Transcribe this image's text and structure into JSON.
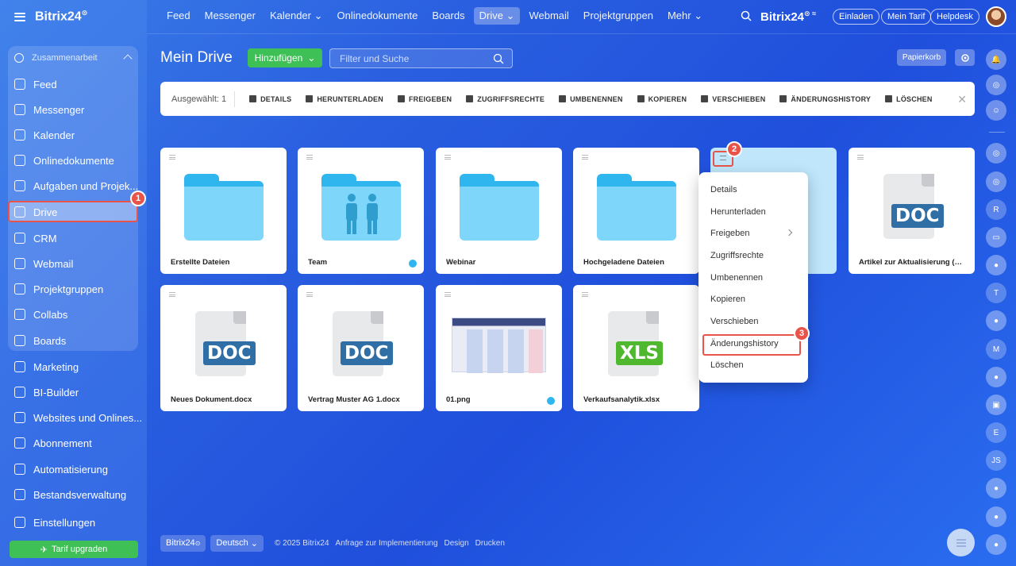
{
  "sidebar": {
    "logo": "Bitrix24",
    "group_label": "Zusammenarbeit",
    "items": [
      {
        "label": "Feed",
        "icon": "feed-icon"
      },
      {
        "label": "Messenger",
        "icon": "chat-icon"
      },
      {
        "label": "Kalender",
        "icon": "calendar-icon"
      },
      {
        "label": "Onlinedokumente",
        "icon": "document-icon"
      },
      {
        "label": "Aufgaben und Projek...",
        "icon": "tasks-icon"
      },
      {
        "label": "Drive",
        "icon": "drive-icon"
      },
      {
        "label": "CRM",
        "icon": "crm-icon"
      },
      {
        "label": "Webmail",
        "icon": "mail-icon"
      },
      {
        "label": "Projektgruppen",
        "icon": "group-icon"
      },
      {
        "label": "Collabs",
        "icon": "collab-icon"
      },
      {
        "label": "Boards",
        "icon": "board-icon"
      },
      {
        "label": "Marketing",
        "icon": "marketing-icon"
      },
      {
        "label": "BI-Builder",
        "icon": "chart-icon"
      },
      {
        "label": "Websites und Onlines...",
        "icon": "cart-icon"
      },
      {
        "label": "Abonnement",
        "icon": "subscription-icon"
      },
      {
        "label": "Automatisierung",
        "icon": "automation-icon"
      },
      {
        "label": "Bestandsverwaltung",
        "icon": "inventory-icon"
      },
      {
        "label": "Einstellungen",
        "icon": "settings-icon"
      }
    ],
    "upgrade_label": "Tarif upgraden",
    "badge_1": "1"
  },
  "topnav": {
    "items": [
      "Feed",
      "Messenger",
      "Kalender ⌄",
      "Onlinedokumente",
      "Boards",
      "Drive ⌄",
      "Webmail",
      "Projektgruppen",
      "Mehr ⌄"
    ],
    "brand": "Bitrix24",
    "invite": "Einladen",
    "plan": "Mein Tarif",
    "helpdesk": "Helpdesk"
  },
  "header": {
    "title": "Mein Drive",
    "add_label": "Hinzufügen",
    "search_placeholder": "Filter und Suche",
    "trash_label": "Papierkorb"
  },
  "actionbar": {
    "selected": "Ausgewählt: 1",
    "actions": [
      "DETAILS",
      "HERUNTERLADEN",
      "FREIGEBEN",
      "ZUGRIFFSRECHTE",
      "UMBENENNEN",
      "KOPIEREN",
      "VERSCHIEBEN",
      "ÄNDERUNGSHISTORY",
      "LÖSCHEN"
    ]
  },
  "files": [
    {
      "name": "Erstellte Dateien",
      "type": "folder"
    },
    {
      "name": "Team",
      "type": "team-folder"
    },
    {
      "name": "Webinar",
      "type": "folder"
    },
    {
      "name": "Hochgeladene Dateien",
      "type": "folder"
    },
    {
      "name": "",
      "type": "folder-selected"
    },
    {
      "name": "Artikel zur Aktualisierung (M...",
      "type": "doc",
      "ext": "DOC"
    },
    {
      "name": "Neues Dokument.docx",
      "type": "doc",
      "ext": "DOC"
    },
    {
      "name": "Vertrag Muster AG 1.docx",
      "type": "doc",
      "ext": "DOC"
    },
    {
      "name": "01.png",
      "type": "image"
    },
    {
      "name": "Verkaufsanalytik.xlsx",
      "type": "xls",
      "ext": "XLS"
    }
  ],
  "context_menu": {
    "items": [
      "Details",
      "Herunterladen",
      "Freigeben",
      "Zugriffsrechte",
      "Umbenennen",
      "Kopieren",
      "Verschieben",
      "Änderungshistory",
      "Löschen"
    ],
    "badge_2": "2",
    "badge_3": "3"
  },
  "rail": {
    "letters": [
      "R",
      "T",
      "M",
      "E",
      "JS"
    ]
  },
  "footer": {
    "brand": "Bitrix24",
    "language": "Deutsch",
    "copyright": "© 2025 Bitrix24",
    "links": [
      "Anfrage zur Implementierung",
      "Design",
      "Drucken"
    ]
  },
  "colors": {
    "accent_green": "#3ec056",
    "highlight_red": "#e8544a",
    "folder_blue": "#7fd6fb",
    "doc_blue": "#2f6fa6",
    "xls_green": "#50b82e"
  }
}
